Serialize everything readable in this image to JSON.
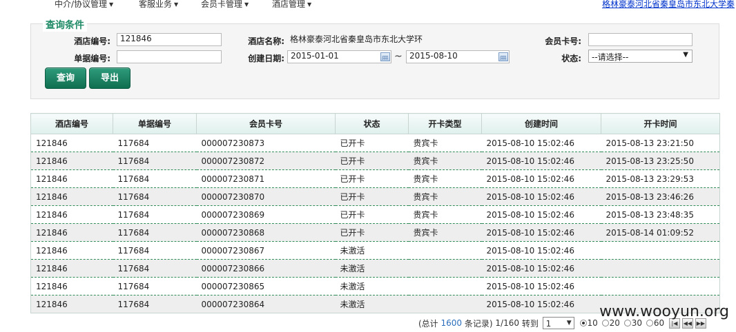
{
  "nav": {
    "menus": [
      {
        "label": "中介/协议管理"
      },
      {
        "label": "客服业务"
      },
      {
        "label": "会员卡管理"
      },
      {
        "label": "酒店管理"
      }
    ],
    "hotel_link": "格林豪泰河北省秦皇岛市东北大学秦"
  },
  "query": {
    "legend": "查询条件",
    "hotel_code_label": "酒店编号:",
    "hotel_code_value": "121846",
    "hotel_name_label": "酒店名称:",
    "hotel_name_value": "格林豪泰河北省秦皇岛市东北大学环",
    "member_card_label": "会员卡号:",
    "member_card_value": "",
    "bill_no_label": "单据编号:",
    "bill_no_value": "",
    "create_date_label": "创建日期:",
    "date_from": "2015-01-01",
    "tilde": "~",
    "date_to": "2015-08-10",
    "status_label": "状态:",
    "status_value": "--请选择--",
    "query_button": "查询",
    "export_button": "导出"
  },
  "table": {
    "columns": [
      "酒店编号",
      "单据编号",
      "会员卡号",
      "状态",
      "开卡类型",
      "创建时间",
      "开卡时间"
    ],
    "rows": [
      [
        "121846",
        "117684",
        "000007230873",
        "已开卡",
        "贵宾卡",
        "2015-08-10 15:02:46",
        "2015-08-13 23:21:50"
      ],
      [
        "121846",
        "117684",
        "000007230872",
        "已开卡",
        "贵宾卡",
        "2015-08-10 15:02:46",
        "2015-08-13 23:25:50"
      ],
      [
        "121846",
        "117684",
        "000007230871",
        "已开卡",
        "贵宾卡",
        "2015-08-10 15:02:46",
        "2015-08-13 23:29:53"
      ],
      [
        "121846",
        "117684",
        "000007230870",
        "已开卡",
        "贵宾卡",
        "2015-08-10 15:02:46",
        "2015-08-13 23:46:26"
      ],
      [
        "121846",
        "117684",
        "000007230869",
        "已开卡",
        "贵宾卡",
        "2015-08-10 15:02:46",
        "2015-08-13 23:48:35"
      ],
      [
        "121846",
        "117684",
        "000007230868",
        "已开卡",
        "贵宾卡",
        "2015-08-10 15:02:46",
        "2015-08-14 01:09:52"
      ],
      [
        "121846",
        "117684",
        "000007230867",
        "未激活",
        "",
        "2015-08-10 15:02:46",
        ""
      ],
      [
        "121846",
        "117684",
        "000007230866",
        "未激活",
        "",
        "2015-08-10 15:02:46",
        ""
      ],
      [
        "121846",
        "117684",
        "000007230865",
        "未激活",
        "",
        "2015-08-10 15:02:46",
        ""
      ],
      [
        "121846",
        "117684",
        "000007230864",
        "未激活",
        "",
        "2015-08-10 15:02:46",
        ""
      ]
    ]
  },
  "pager": {
    "total_prefix": "(总计",
    "total_count": "1600",
    "total_suffix": "条记录)",
    "page_info": "1/160",
    "goto_label": "转到",
    "current_page": "1",
    "page_sizes": [
      "10",
      "20",
      "30",
      "60"
    ],
    "selected_size": "10"
  },
  "watermark": "www.wooyun.org",
  "colors": {
    "accent": "#1f8a66",
    "row_alt": "#eeeeee",
    "link": "#0033cc"
  }
}
